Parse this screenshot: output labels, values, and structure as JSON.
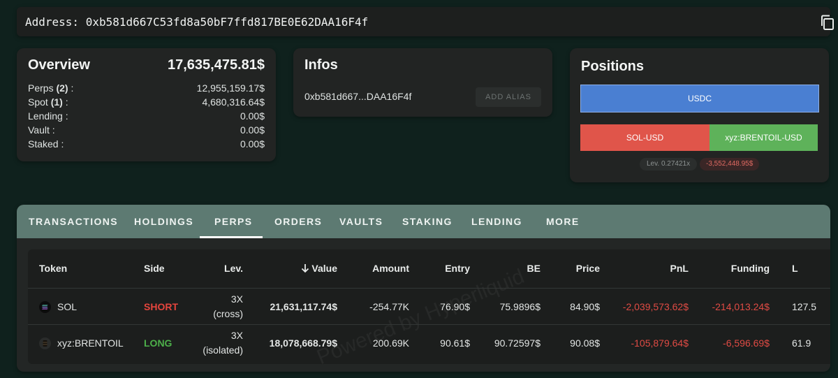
{
  "address": {
    "label": "Address:",
    "value": "0xb581d667C53fd8a50bF7ffd817BE0E62DAA16F4f"
  },
  "overview": {
    "title": "Overview",
    "total": "17,635,475.81$",
    "rows": [
      {
        "label_pre": "Perps ",
        "label_count": "(2)",
        "label_post": " :",
        "value": "12,955,159.17$"
      },
      {
        "label_pre": "Spot ",
        "label_count": "(1)",
        "label_post": " :",
        "value": "4,680,316.64$"
      },
      {
        "label_pre": "Lending :",
        "label_count": "",
        "label_post": "",
        "value": "0.00$"
      },
      {
        "label_pre": "Vault :",
        "label_count": "",
        "label_post": "",
        "value": "0.00$"
      },
      {
        "label_pre": "Staked :",
        "label_count": "",
        "label_post": "",
        "value": "0.00$"
      }
    ]
  },
  "infos": {
    "title": "Infos",
    "address_short": "0xb581d667...DAA16F4f",
    "add_alias": "ADD ALIAS"
  },
  "positions": {
    "title": "Positions",
    "blocks": [
      "USDC",
      "SOL-USD",
      "xyz:BRENTOIL-USD"
    ],
    "lev_label": "Lev.",
    "lev_value": "0.27421x",
    "pnl": "-3,552,448.95$"
  },
  "tabs": [
    "TRANSACTIONS",
    "HOLDINGS",
    "PERPS",
    "ORDERS",
    "VAULTS",
    "STAKING",
    "LENDING",
    "MORE"
  ],
  "active_tab": "PERPS",
  "table": {
    "headers": [
      "Token",
      "Side",
      "Lev.",
      "Value",
      "Amount",
      "Entry",
      "BE",
      "Price",
      "PnL",
      "Funding",
      "L"
    ],
    "sort_icon": "arrow-down-icon",
    "rows": [
      {
        "token": "SOL",
        "side": "SHORT",
        "lev": "3X",
        "lev_mode": "(cross)",
        "value": "21,631,117.74$",
        "amount": "-254.77K",
        "entry": "76.90$",
        "be": "75.9896$",
        "price": "84.90$",
        "pnl": "-2,039,573.62$",
        "funding": "-214,013.24$",
        "liq": "127.5"
      },
      {
        "token": "xyz:BRENTOIL",
        "side": "LONG",
        "lev": "3X",
        "lev_mode": "(isolated)",
        "value": "18,078,668.79$",
        "amount": "200.69K",
        "entry": "90.61$",
        "be": "90.72597$",
        "price": "90.08$",
        "pnl": "-105,879.64$",
        "funding": "-6,596.69$",
        "liq": "61.9"
      }
    ]
  },
  "watermark": "Powered by Hyperliquid",
  "colors": {
    "background": "#0f211d",
    "tab_bar": "#5d7a72",
    "usdc": "#4a7fd2",
    "short": "#e0554a",
    "long": "#5eb25a",
    "negative": "#e04b44"
  }
}
